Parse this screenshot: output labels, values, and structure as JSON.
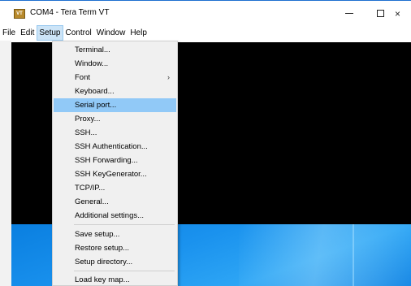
{
  "window": {
    "title": "COM4 - Tera Term VT",
    "icon_text": "VT",
    "minimize_icon": "minimize-icon",
    "maximize_icon": "maximize-icon",
    "close_symbol": "×"
  },
  "menubar": {
    "items": [
      {
        "label": "File"
      },
      {
        "label": "Edit"
      },
      {
        "label": "Setup",
        "active": true
      },
      {
        "label": "Control"
      },
      {
        "label": "Window"
      },
      {
        "label": "Help"
      }
    ]
  },
  "setup_menu": {
    "items": [
      {
        "label": "Terminal..."
      },
      {
        "label": "Window..."
      },
      {
        "label": "Font",
        "submenu_arrow": "›"
      },
      {
        "label": "Keyboard..."
      },
      {
        "label": "Serial port...",
        "highlighted": true
      },
      {
        "label": "Proxy..."
      },
      {
        "label": "SSH..."
      },
      {
        "label": "SSH Authentication..."
      },
      {
        "label": "SSH Forwarding..."
      },
      {
        "label": "SSH KeyGenerator..."
      },
      {
        "label": "TCP/IP..."
      },
      {
        "label": "General..."
      },
      {
        "label": "Additional settings..."
      },
      {
        "label": "Save setup..."
      },
      {
        "label": "Restore setup..."
      },
      {
        "label": "Setup directory..."
      },
      {
        "label": "Load key map..."
      }
    ]
  },
  "colors": {
    "terminal_bg": "#000000",
    "menu_highlight": "#91c9f7",
    "menubar_active": "#cce4f7",
    "desktop_blue": "#1a92ee"
  }
}
